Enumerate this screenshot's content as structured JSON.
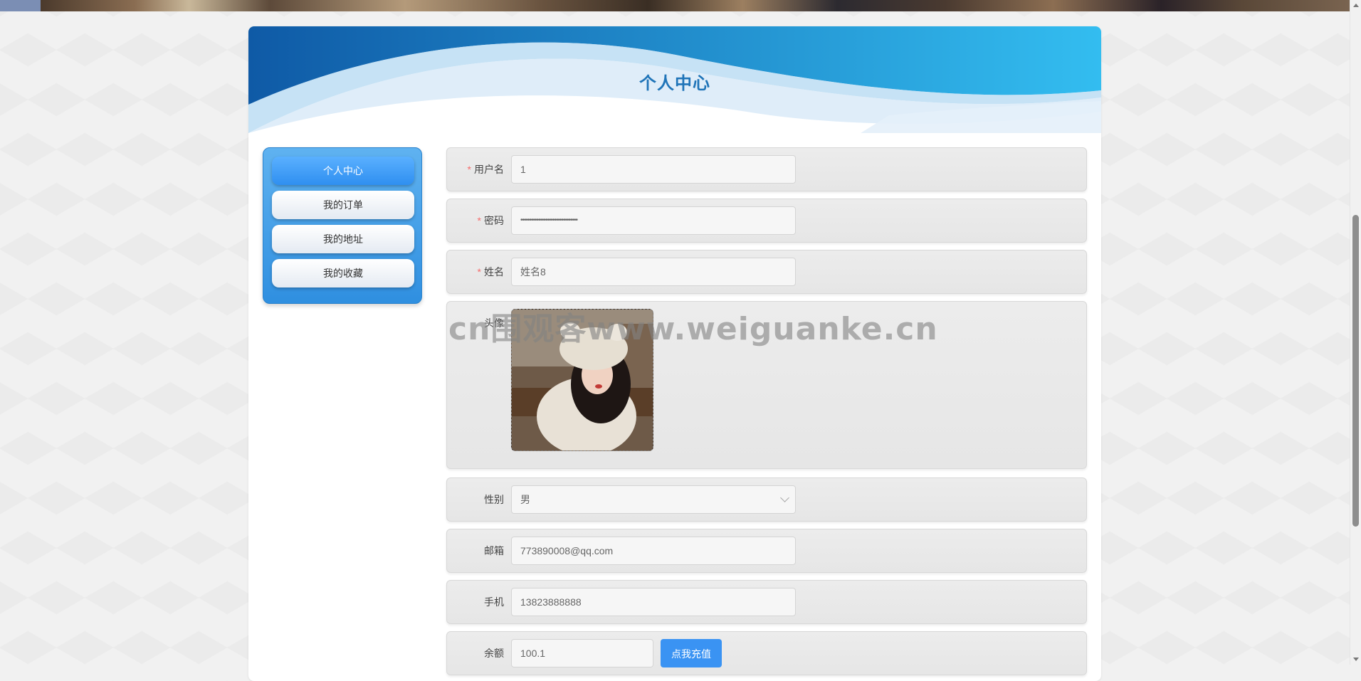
{
  "page": {
    "title": "个人中心"
  },
  "sidebar": {
    "items": [
      {
        "label": "个人中心",
        "active": true
      },
      {
        "label": "我的订单",
        "active": false
      },
      {
        "label": "我的地址",
        "active": false
      },
      {
        "label": "我的收藏",
        "active": false
      }
    ]
  },
  "form": {
    "username": {
      "label": "用户名",
      "value": "1",
      "required": true
    },
    "password": {
      "label": "密码",
      "value": "••••••••••••••••••••••••••••••••",
      "required": true
    },
    "name": {
      "label": "姓名",
      "value": "姓名8",
      "required": true
    },
    "avatar": {
      "label": "头像"
    },
    "gender": {
      "label": "性别",
      "value": "男"
    },
    "email": {
      "label": "邮箱",
      "value": "773890008@qq.com"
    },
    "phone": {
      "label": "手机",
      "value": "13823888888"
    },
    "balance": {
      "label": "余额",
      "value": "100.1",
      "button_label": "点我充值"
    }
  },
  "watermark": "cn围观客www.weiguanke.cn",
  "colors": {
    "accent": "#3a93f3",
    "title": "#1f74b8",
    "required": "#f56c6c"
  }
}
